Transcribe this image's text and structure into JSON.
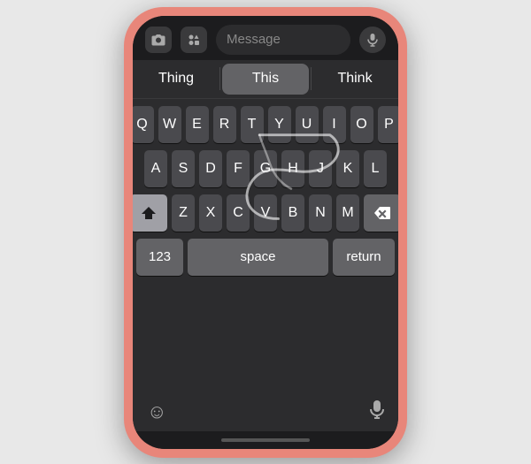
{
  "phone": {
    "message_placeholder": "Message",
    "predictive": {
      "left": "Thing",
      "center": "This",
      "right": "Think"
    },
    "keyboard": {
      "rows": [
        [
          "Q",
          "W",
          "E",
          "R",
          "T",
          "Y",
          "U",
          "I",
          "O",
          "P"
        ],
        [
          "A",
          "S",
          "D",
          "F",
          "G",
          "H",
          "J",
          "K",
          "L"
        ],
        [
          "Z",
          "X",
          "C",
          "V",
          "B",
          "N",
          "M"
        ]
      ],
      "bottom_left": "123",
      "space": "space",
      "return": "return"
    },
    "icons": {
      "camera": "📷",
      "apps": "🅐",
      "mic": "🎤",
      "emoji": "😊",
      "mic_bottom": "🎤"
    }
  }
}
